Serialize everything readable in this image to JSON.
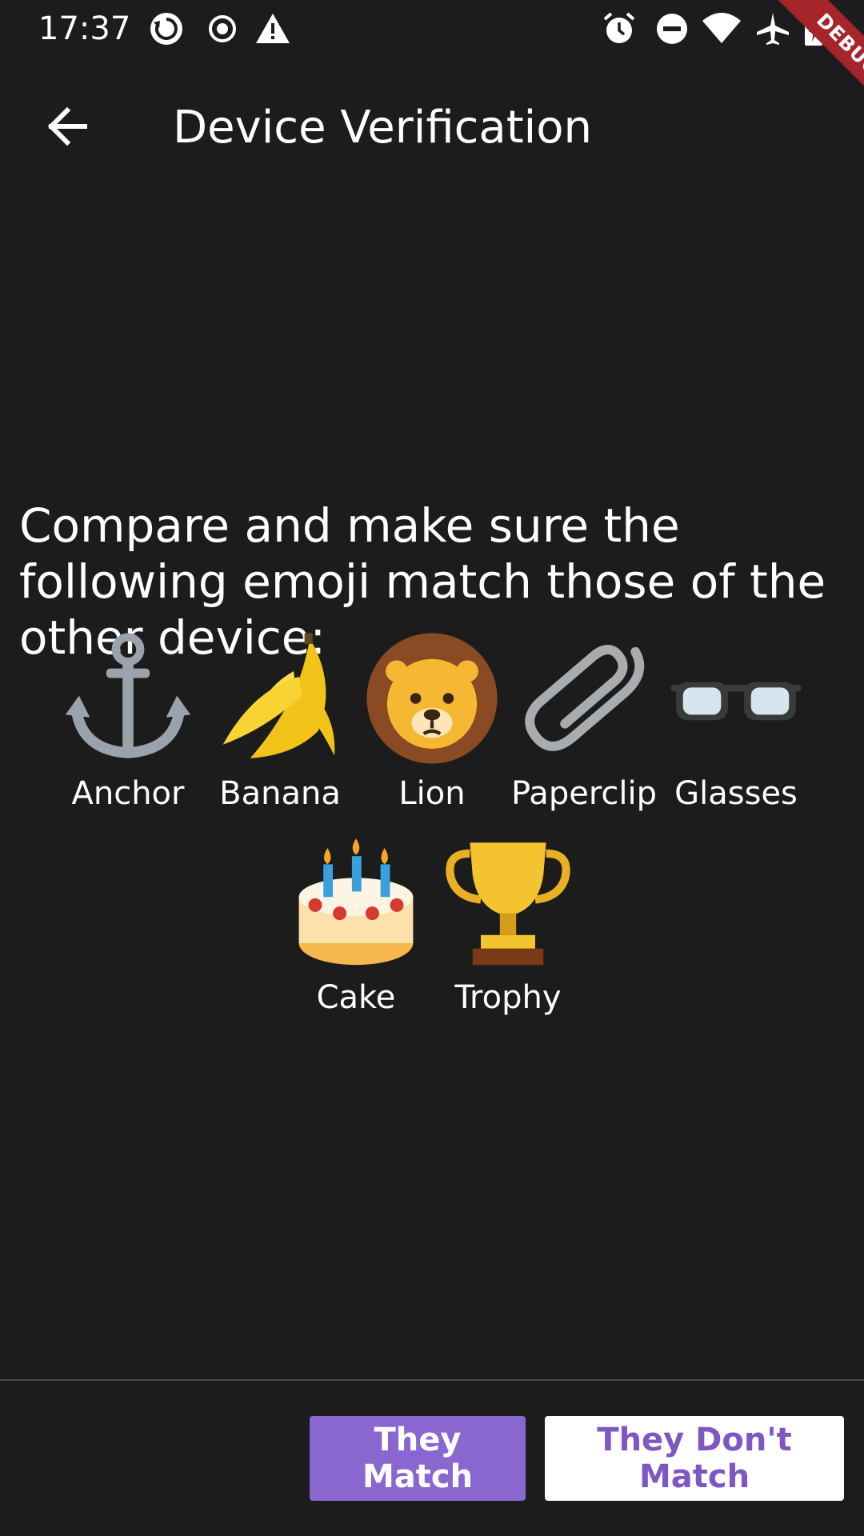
{
  "status_bar": {
    "time": "17:37",
    "left_icons": [
      "sync-icon",
      "record-icon",
      "warning-icon"
    ],
    "right_icons": [
      "alarm-icon",
      "do-not-disturb-icon",
      "wifi-icon",
      "airplane-icon",
      "battery-charging-icon"
    ]
  },
  "debug_banner": "DEBUG",
  "app_bar": {
    "back_icon": "arrow-back-icon",
    "title": "Device Verification"
  },
  "instructions": "Compare and make sure the following emoji match those of the other device:",
  "emojis": [
    {
      "icon": "anchor-icon",
      "label": "Anchor"
    },
    {
      "icon": "banana-icon",
      "label": "Banana"
    },
    {
      "icon": "lion-icon",
      "label": "Lion"
    },
    {
      "icon": "paperclip-icon",
      "label": "Paperclip"
    },
    {
      "icon": "glasses-icon",
      "label": "Glasses"
    },
    {
      "icon": "cake-icon",
      "label": "Cake"
    },
    {
      "icon": "trophy-icon",
      "label": "Trophy"
    }
  ],
  "buttons": {
    "match": "They Match",
    "no_match": "They Don't Match"
  },
  "colors": {
    "background": "#1c1c1d",
    "primary_button": "#8a66d0",
    "secondary_button_text": "#7e57c2",
    "debug_banner": "#a5252b"
  }
}
